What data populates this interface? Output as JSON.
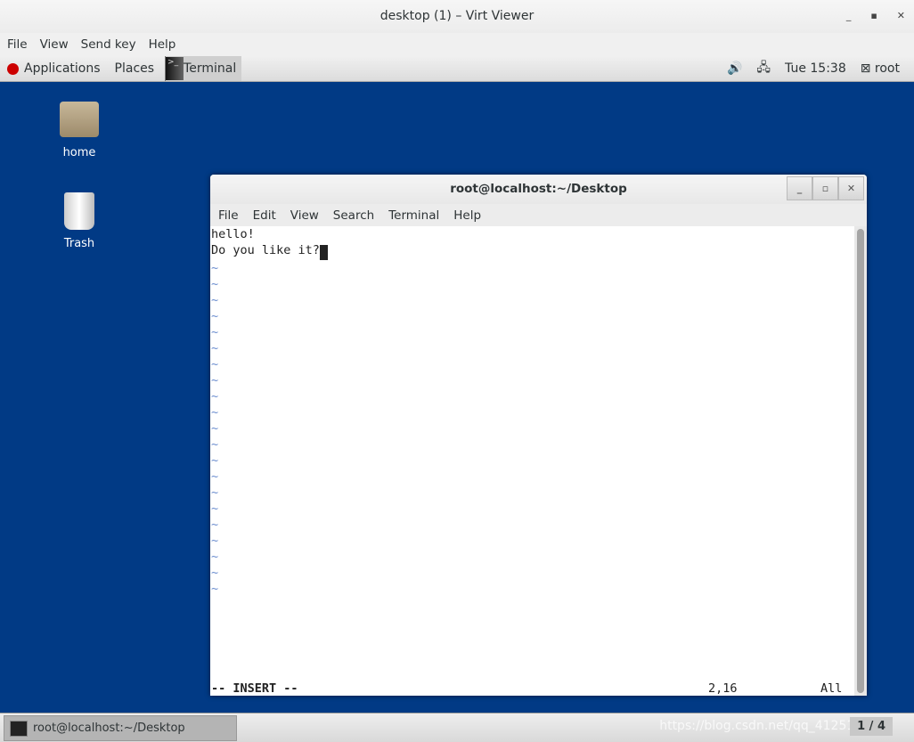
{
  "window": {
    "title": "desktop (1) – Virt Viewer",
    "minimize": "‗",
    "maximize": "▫",
    "close": "✕"
  },
  "menu": [
    "File",
    "View",
    "Send key",
    "Help"
  ],
  "panel": {
    "applications": "Applications",
    "places": "Places",
    "task": "Terminal",
    "time": "Tue 15:38",
    "user": "root",
    "volume_icon": "speaker-icon",
    "network_icon": "network-icon"
  },
  "desktop_icons": [
    {
      "label": "home",
      "icon": "home-folder-icon"
    },
    {
      "label": "Trash",
      "icon": "trash-icon"
    }
  ],
  "terminal": {
    "title": "root@localhost:~/Desktop",
    "menu": [
      "File",
      "Edit",
      "View",
      "Search",
      "Terminal",
      "Help"
    ],
    "lines": [
      "hello!",
      "Do you like it?"
    ],
    "tilde": "~",
    "mode": "-- INSERT --",
    "position": "2,16",
    "scroll": "All"
  },
  "taskbar": {
    "item": "root@localhost:~/Desktop",
    "workspace": "1 / 4",
    "watermark": "https://blog.csdn.net/qq_41251046"
  },
  "colors": {
    "desktop": "#013a85"
  }
}
